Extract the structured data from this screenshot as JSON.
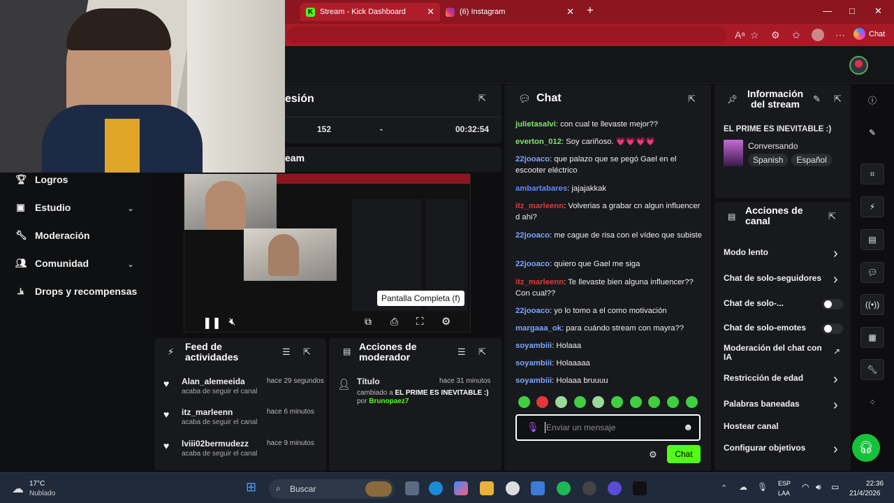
{
  "browser": {
    "tabs": [
      {
        "title": "Stream - Kick Dashboard",
        "favicon": "K"
      },
      {
        "title": "(6) Instagram"
      }
    ],
    "new_tab": "+",
    "window_controls": [
      "—",
      "□",
      "✕"
    ],
    "copilot_label": "Chat"
  },
  "session": {
    "title_partial": "esión",
    "stats": [
      "152",
      "-",
      "00:32:54"
    ],
    "stream_partial": "eam"
  },
  "sidebar": {
    "items": [
      {
        "label": "Logros",
        "icon": "trophy-icon",
        "has_chevron": false
      },
      {
        "label": "Estudio",
        "icon": "studio-icon",
        "has_chevron": true
      },
      {
        "label": "Moderación",
        "icon": "wrench-icon",
        "has_chevron": false
      },
      {
        "label": "Comunidad",
        "icon": "users-icon",
        "has_chevron": true
      },
      {
        "label": "Drops y recompensas",
        "icon": "drops-icon",
        "has_chevron": false
      }
    ]
  },
  "player": {
    "tooltip": "Pantalla Completa (f)"
  },
  "chat": {
    "title": "Chat",
    "messages": [
      {
        "user": "julietasalvi",
        "color": "#7ee66b",
        "text": "con cual te llevaste mejor??"
      },
      {
        "user": "everton_012",
        "color": "#7ee66b",
        "text": "Soy cariñoso. 💗💗💗💗"
      },
      {
        "user": "22jooaco",
        "color": "#7aa7ff",
        "text": "que palazo que se pegó Gael en el escooter eléctrico"
      },
      {
        "user": "ambartabares",
        "color": "#5a8dff",
        "text": "jajajakkak"
      },
      {
        "user": "itz_marleenn",
        "color": "#e03a3a",
        "text": "Volverias a grabar cn algun influencer d ahi?"
      },
      {
        "user": "22jooaco",
        "color": "#7aa7ff",
        "text": "me cague de risa con el vídeo que subiste"
      },
      {
        "user": "22jooaco",
        "color": "#7aa7ff",
        "text": "quiero que Gael me siga"
      },
      {
        "user": "itz_marleenn",
        "color": "#e03a3a",
        "text": "Te llevaste bien alguna influencer?? Con cual??"
      },
      {
        "user": "22jooaco",
        "color": "#7aa7ff",
        "text": "yo lo tomo a el como motivación"
      },
      {
        "user": "margaaa_ok",
        "color": "#7aa7ff",
        "text": "para cuándo stream con mayra??"
      },
      {
        "user": "soyambiii",
        "color": "#7aa7ff",
        "text": "Holaaa"
      },
      {
        "user": "soyambiii",
        "color": "#7aa7ff",
        "text": "Holaaaaa"
      },
      {
        "user": "soyambiii",
        "color": "#7aa7ff",
        "text": "Holaaa bruuuu"
      }
    ],
    "input_placeholder": "Enviar un mensaje",
    "send_label": "Chat"
  },
  "stream_info": {
    "title": "Información del stream",
    "stream_title": "EL PRIME ES INEVITABLE :)",
    "category": "Conversando",
    "tags": [
      "Spanish",
      "Español"
    ]
  },
  "channel_actions": {
    "title": "Acciones de canal",
    "items": [
      {
        "label": "Modo lento",
        "control": "chevron"
      },
      {
        "label": "Chat de solo-seguidores",
        "control": "chevron"
      },
      {
        "label": "Chat de solo-...",
        "control": "toggle"
      },
      {
        "label": "Chat de solo-emotes",
        "control": "toggle"
      },
      {
        "label": "Moderación del chat con IA",
        "control": "external"
      },
      {
        "label": "Restricción de edad",
        "control": "chevron"
      },
      {
        "label": "Palabras baneadas",
        "control": "chevron"
      },
      {
        "label": "Hostear canal",
        "control": "none"
      },
      {
        "label": "Configurar objetivos",
        "control": "chevron"
      }
    ]
  },
  "activity_feed": {
    "title": "Feed de actividades",
    "items": [
      {
        "name": "Alan_alemeeida",
        "time": "hace 29 segundos",
        "action": "acaba de seguir el canal"
      },
      {
        "name": "itz_marleenn",
        "time": "hace 6 minutos",
        "action": "acaba de seguir el canal"
      },
      {
        "name": "lviii02bermudezz",
        "time": "hace 9 minutos",
        "action": "acaba de seguir el canal"
      }
    ]
  },
  "mod_actions": {
    "title": "Acciones de moderador",
    "entry": {
      "label": "Título",
      "time": "hace 31 minutos",
      "changed_prefix": "cambiado a",
      "new_value": "EL PRIME ES INEVITABLE :)",
      "by_prefix": "por",
      "by_user": "Brunopaez7"
    }
  },
  "taskbar": {
    "weather_temp": "17°C",
    "weather_desc": "Nublado",
    "search_label": "Buscar",
    "lang_top": "ESP",
    "lang_bottom": "LAA",
    "time": "22:36",
    "date": "21/4/2026"
  },
  "colors": {
    "kick_green": "#53fc18",
    "browser_red": "#a71a26"
  }
}
